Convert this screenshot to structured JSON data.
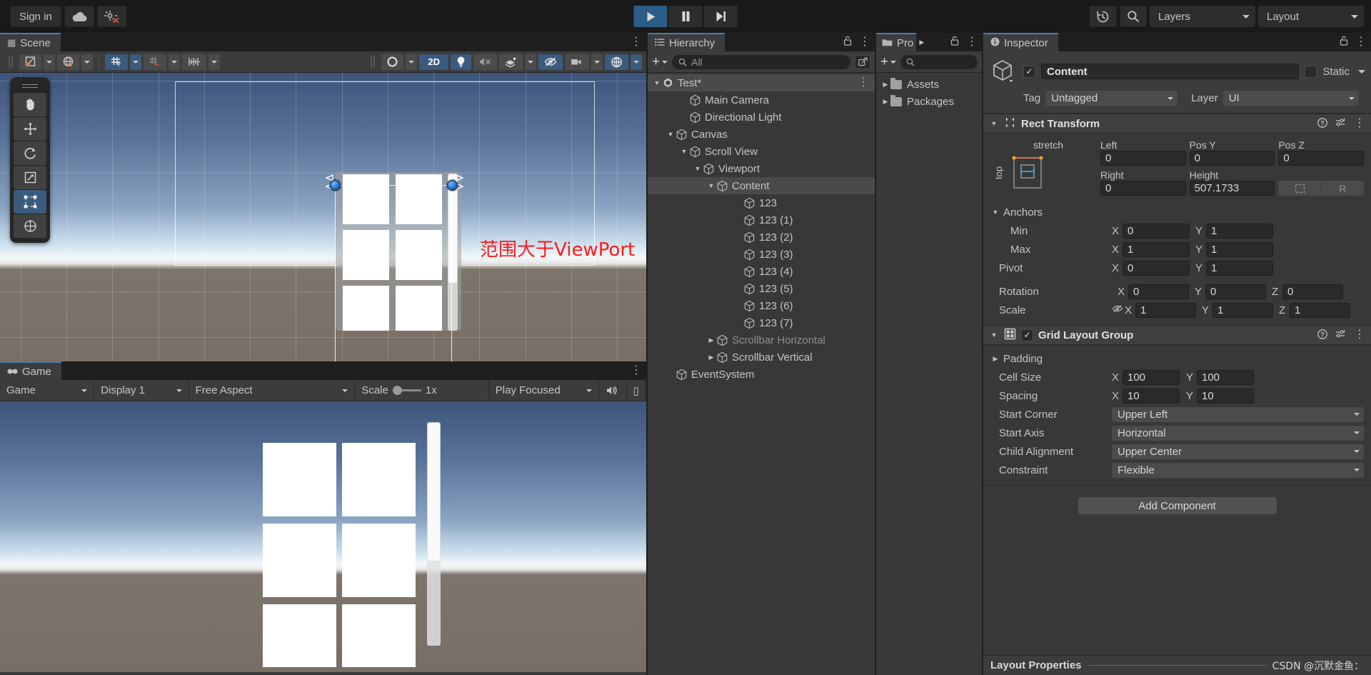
{
  "topbar": {
    "sign_in": "Sign in",
    "cloud_icon": "cloud-icon",
    "account_icon": "collab-error-icon",
    "play": "play-icon",
    "pause": "pause-icon",
    "step": "step-icon",
    "history_icon": "undo-history-icon",
    "search_icon": "search-icon",
    "layers": "Layers",
    "layout": "Layout"
  },
  "scene": {
    "tab_label": "Scene",
    "tab_icon": "scene-grid-icon",
    "toolbar": {
      "tool_handle_pos": "pivot-icon",
      "tool_handle_rot": "global-icon",
      "grid_visibility": "grid-axis-y-icon",
      "grid_snapping": "grid-snap-icon",
      "snap_increment": "snap-ruler-icon",
      "draw_mode": "shaded-icon",
      "mode_2d": "2D",
      "lighting": "light-bulb-icon",
      "audio": "audio-mute-icon",
      "fx": "effects-icon",
      "hidden_objects": "visibility-off-icon",
      "camera": "scene-camera-icon",
      "gizmos": "gizmos-icon"
    },
    "tools": [
      {
        "name": "hand-tool",
        "icon": "hand-icon",
        "active": false
      },
      {
        "name": "move-tool",
        "icon": "move-icon",
        "active": false
      },
      {
        "name": "rotate-tool",
        "icon": "rotate-icon",
        "active": false
      },
      {
        "name": "scale-tool",
        "icon": "scale-icon",
        "active": false
      },
      {
        "name": "rect-tool",
        "icon": "rect-transform-icon",
        "active": true
      },
      {
        "name": "transform-tool",
        "icon": "transform-icon",
        "active": false
      }
    ],
    "annotation": "范围大于ViewPort"
  },
  "game": {
    "tab_label": "Game",
    "tab_icon": "game-controller-icon",
    "toolbar": {
      "target": "Game",
      "display": "Display 1",
      "aspect": "Free Aspect",
      "scale_label": "Scale",
      "scale_value": "1x",
      "play_mode": "Play Focused",
      "mute_icon": "audio-on-icon"
    }
  },
  "hierarchy": {
    "tab_label": "Hierarchy",
    "tab_icon": "hierarchy-list-icon",
    "search_placeholder": "All",
    "add_label": "+",
    "items": [
      {
        "label": "Test*",
        "depth": 0,
        "arrow": "down",
        "selected": true,
        "dim": false,
        "icon": "unity-scene-icon",
        "kebab": true
      },
      {
        "label": "Main Camera",
        "depth": 2,
        "arrow": "none",
        "selected": false,
        "dim": false,
        "icon": "cube-icon",
        "kebab": false
      },
      {
        "label": "Directional Light",
        "depth": 2,
        "arrow": "none",
        "selected": false,
        "dim": false,
        "icon": "cube-icon",
        "kebab": false
      },
      {
        "label": "Canvas",
        "depth": 1,
        "arrow": "down",
        "selected": false,
        "dim": false,
        "icon": "cube-icon",
        "kebab": false
      },
      {
        "label": "Scroll View",
        "depth": 2,
        "arrow": "down",
        "selected": false,
        "dim": false,
        "icon": "cube-icon",
        "kebab": false
      },
      {
        "label": "Viewport",
        "depth": 3,
        "arrow": "down",
        "selected": false,
        "dim": false,
        "icon": "cube-icon",
        "kebab": false
      },
      {
        "label": "Content",
        "depth": 4,
        "arrow": "down",
        "selected": true,
        "dim": false,
        "icon": "cube-icon",
        "kebab": false
      },
      {
        "label": "123",
        "depth": 6,
        "arrow": "none",
        "selected": false,
        "dim": false,
        "icon": "cube-icon",
        "kebab": false
      },
      {
        "label": "123 (1)",
        "depth": 6,
        "arrow": "none",
        "selected": false,
        "dim": false,
        "icon": "cube-icon",
        "kebab": false
      },
      {
        "label": "123 (2)",
        "depth": 6,
        "arrow": "none",
        "selected": false,
        "dim": false,
        "icon": "cube-icon",
        "kebab": false
      },
      {
        "label": "123 (3)",
        "depth": 6,
        "arrow": "none",
        "selected": false,
        "dim": false,
        "icon": "cube-icon",
        "kebab": false
      },
      {
        "label": "123 (4)",
        "depth": 6,
        "arrow": "none",
        "selected": false,
        "dim": false,
        "icon": "cube-icon",
        "kebab": false
      },
      {
        "label": "123 (5)",
        "depth": 6,
        "arrow": "none",
        "selected": false,
        "dim": false,
        "icon": "cube-icon",
        "kebab": false
      },
      {
        "label": "123 (6)",
        "depth": 6,
        "arrow": "none",
        "selected": false,
        "dim": false,
        "icon": "cube-icon",
        "kebab": false
      },
      {
        "label": "123 (7)",
        "depth": 6,
        "arrow": "none",
        "selected": false,
        "dim": false,
        "icon": "cube-icon",
        "kebab": false
      },
      {
        "label": "Scrollbar Horizontal",
        "depth": 4,
        "arrow": "right",
        "selected": false,
        "dim": true,
        "icon": "cube-icon",
        "kebab": false
      },
      {
        "label": "Scrollbar Vertical",
        "depth": 4,
        "arrow": "right",
        "selected": false,
        "dim": false,
        "icon": "cube-icon",
        "kebab": false
      },
      {
        "label": "EventSystem",
        "depth": 1,
        "arrow": "none",
        "selected": false,
        "dim": false,
        "icon": "cube-icon",
        "kebab": false
      }
    ]
  },
  "project": {
    "tab_label": "Pro",
    "tab_icon": "folder-icon",
    "add_label": "+",
    "search_icon": "search-icon",
    "items": [
      {
        "label": "Assets",
        "arrow": "right"
      },
      {
        "label": "Packages",
        "arrow": "right"
      }
    ]
  },
  "inspector": {
    "tab_label": "Inspector",
    "tab_icon": "info-icon",
    "object": {
      "enabled": true,
      "name": "Content",
      "static_label": "Static",
      "static_checked": false,
      "tag_label": "Tag",
      "tag_value": "Untagged",
      "layer_label": "Layer",
      "layer_value": "UI"
    },
    "rect_transform": {
      "title": "Rect Transform",
      "anchor_preset": "stretch",
      "anchor_preset_side": "top",
      "fields": [
        {
          "label": "Left",
          "value": "0"
        },
        {
          "label": "Pos Y",
          "value": "0"
        },
        {
          "label": "Pos Z",
          "value": "0"
        },
        {
          "label": "Right",
          "value": "0"
        },
        {
          "label": "Height",
          "value": "507.1733"
        }
      ],
      "blueprint_btn": "blueprint-mode-icon",
      "raw_btn": "R",
      "anchors_label": "Anchors",
      "min_label": "Min",
      "min_x": "0",
      "min_y": "1",
      "max_label": "Max",
      "max_x": "1",
      "max_y": "1",
      "pivot_label": "Pivot",
      "pivot_x": "0",
      "pivot_y": "1",
      "rotation_label": "Rotation",
      "rot_x": "0",
      "rot_y": "0",
      "rot_z": "0",
      "scale_label": "Scale",
      "scale_x": "1",
      "scale_y": "1",
      "scale_z": "1",
      "scale_link_icon": "link-off-icon"
    },
    "grid_layout_group": {
      "title": "Grid Layout Group",
      "enabled": true,
      "padding_label": "Padding",
      "cell_size_label": "Cell Size",
      "cell_size_x": "100",
      "cell_size_y": "100",
      "spacing_label": "Spacing",
      "spacing_x": "10",
      "spacing_y": "10",
      "start_corner_label": "Start Corner",
      "start_corner_value": "Upper Left",
      "start_axis_label": "Start Axis",
      "start_axis_value": "Horizontal",
      "child_alignment_label": "Child Alignment",
      "child_alignment_value": "Upper Center",
      "constraint_label": "Constraint",
      "constraint_value": "Flexible"
    },
    "add_component": "Add Component",
    "footer": {
      "title": "Layout Properties",
      "watermark": "CSDN @沉默金鱼："
    }
  },
  "colors": {
    "accent_blue": "#2c5d87",
    "panel_bg": "#383838",
    "toolbar_bg": "#3c3c3c",
    "window_bg": "#191919",
    "annotation_red": "#ff1a1a"
  }
}
